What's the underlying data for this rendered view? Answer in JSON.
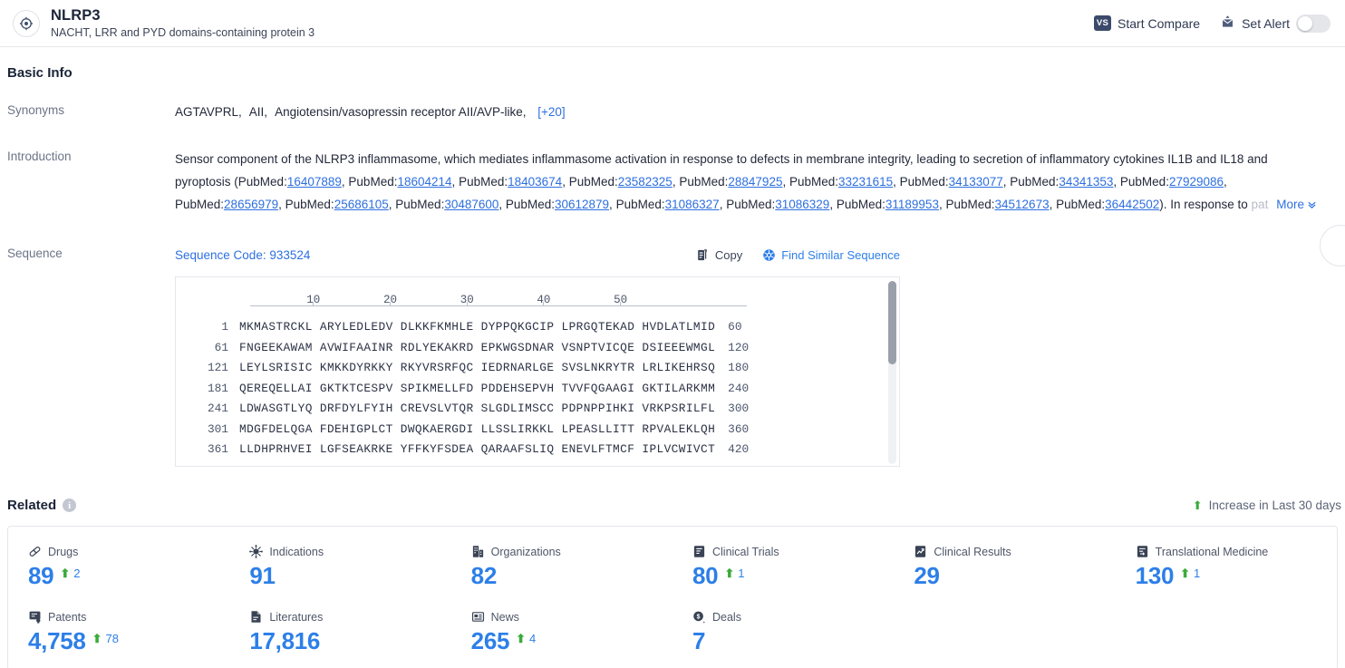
{
  "header": {
    "logo_icon": "target-icon",
    "title": "NLRP3",
    "subtitle": "NACHT, LRR and PYD domains-containing protein 3",
    "compare_label": "Start Compare",
    "compare_badge": "VS",
    "alert_label": "Set Alert",
    "alert_icon": "bell-alert-icon",
    "alert_toggle_on": false
  },
  "basic_info": {
    "section_title": "Basic Info",
    "synonyms": {
      "label": "Synonyms",
      "items": [
        "AGTAVPRL,",
        "AII,",
        "Angiotensin/vasopressin receptor AII/AVP-like,"
      ],
      "more_count": "[+20]"
    },
    "introduction": {
      "label": "Introduction",
      "text_part1": "Sensor component of the NLRP3 inflammasome, which mediates inflammasome activation in response to defects in membrane integrity, leading to secretion of inflammatory cytokines IL1B and IL18 and pyroptosis (",
      "pubmed_prefix": "PubMed:",
      "pubmed_ids": [
        "16407889",
        "18604214",
        "18403674",
        "23582325",
        "28847925",
        "33231615",
        "34133077",
        "34341353",
        "27929086",
        "28656979",
        "25686105",
        "30487600",
        "30612879",
        "31086327",
        "31086329",
        "31189953",
        "34512673",
        "36442502"
      ],
      "text_part2": "). In response to pat",
      "more_label": "More",
      "more_icon": "chevron-down-icon"
    }
  },
  "sequence": {
    "label": "Sequence",
    "code_label": "Sequence Code: 933524",
    "copy_label": "Copy",
    "copy_icon": "copy-icon",
    "find_label": "Find Similar Sequence",
    "find_icon": "find-similar-icon",
    "ruler_ticks": [
      "10",
      "20",
      "30",
      "40",
      "50"
    ],
    "lines": [
      {
        "start": "1",
        "blocks": [
          "MKMASTRCKL",
          "ARYLEDLEDV",
          "DLKKFKMHLE",
          "DYPPQKGCIP",
          "LPRGQTEKAD",
          "HVDLATLMID"
        ],
        "end": "60"
      },
      {
        "start": "61",
        "blocks": [
          "FNGEEKAWAM",
          "AVWIFAAINR",
          "RDLYEKAKRD",
          "EPKWGSDNAR",
          "VSNPTVICQE",
          "DSIEEEWMGL"
        ],
        "end": "120"
      },
      {
        "start": "121",
        "blocks": [
          "LEYLSRISIC",
          "KMKKDYRKKY",
          "RKYVRSRFQC",
          "IEDRNARLGE",
          "SVSLNKRYTR",
          "LRLIKEHRSQ"
        ],
        "end": "180"
      },
      {
        "start": "181",
        "blocks": [
          "QEREQELLAI",
          "GKTKTCESPV",
          "SPIKMELLFD",
          "PDDEHSEPVH",
          "TVVFQGAAGI",
          "GKTILARKMM"
        ],
        "end": "240"
      },
      {
        "start": "241",
        "blocks": [
          "LDWASGTLYQ",
          "DRFDYLFYIH",
          "CREVSLVTQR",
          "SLGDLIMSCC",
          "PDPNPPIHKI",
          "VRKPSRILFL"
        ],
        "end": "300"
      },
      {
        "start": "301",
        "blocks": [
          "MDGFDELQGA",
          "FDEHIGPLCT",
          "DWQKAERGDI",
          "LLSSLIRKKL",
          "LPEASLLITT",
          "RPVALEKLQH"
        ],
        "end": "360"
      },
      {
        "start": "361",
        "blocks": [
          "LLDHPRHVEI",
          "LGFSEAKRKE",
          "YFFKYFSDEA",
          "QARAAFSLIQ",
          "ENEVLFTMCF",
          "IPLVCWIVCT"
        ],
        "end": "420"
      }
    ]
  },
  "related": {
    "title": "Related",
    "info_icon": "info-icon",
    "increase_note": "Increase in Last 30 days",
    "increase_icon": "arrow-up-icon",
    "cards": [
      {
        "icon": "pill-icon",
        "label": "Drugs",
        "value": "89",
        "delta": "2"
      },
      {
        "icon": "virus-icon",
        "label": "Indications",
        "value": "91",
        "delta": ""
      },
      {
        "icon": "building-icon",
        "label": "Organizations",
        "value": "82",
        "delta": ""
      },
      {
        "icon": "clipboard-icon",
        "label": "Clinical Trials",
        "value": "80",
        "delta": "1"
      },
      {
        "icon": "chart-doc-icon",
        "label": "Clinical Results",
        "value": "29",
        "delta": ""
      },
      {
        "icon": "transfer-doc-icon",
        "label": "Translational Medicine",
        "value": "130",
        "delta": "1"
      },
      {
        "icon": "patent-icon",
        "label": "Patents",
        "value": "4,758",
        "delta": "78"
      },
      {
        "icon": "literature-icon",
        "label": "Literatures",
        "value": "17,816",
        "delta": ""
      },
      {
        "icon": "news-icon",
        "label": "News",
        "value": "265",
        "delta": "4"
      },
      {
        "icon": "deals-icon",
        "label": "Deals",
        "value": "7",
        "delta": ""
      }
    ]
  },
  "colors": {
    "accent_blue": "#2d7fe8",
    "link_blue": "#2d6fe0",
    "green": "#3bab3b",
    "dark_navy": "#3b4a6b",
    "border": "#e4e7ec"
  }
}
